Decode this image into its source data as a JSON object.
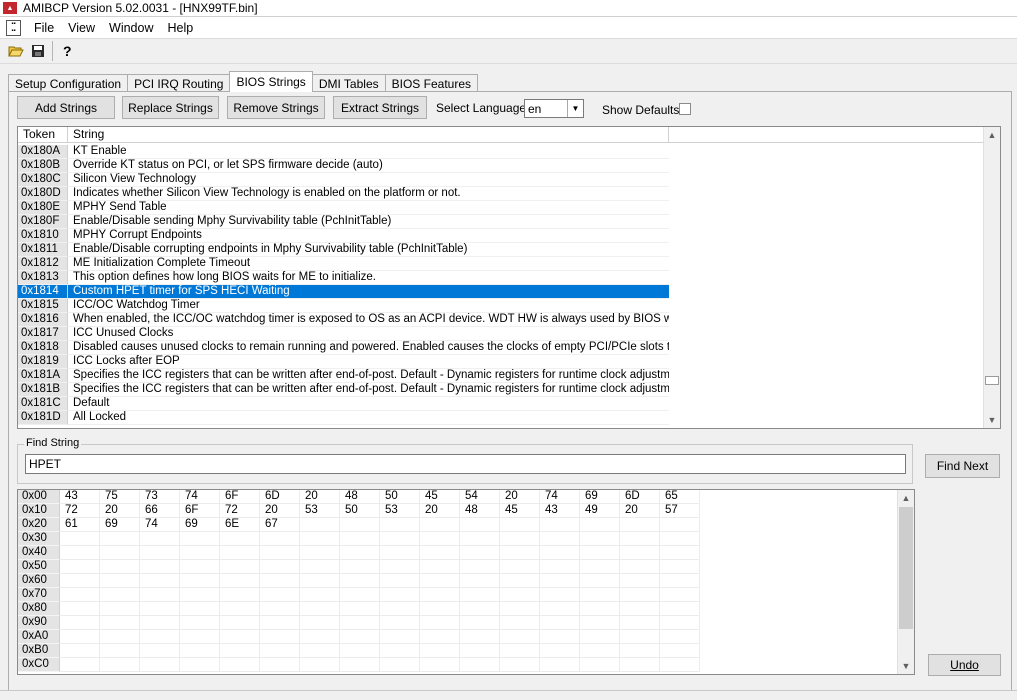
{
  "window": {
    "title": "AMIBCP Version 5.02.0031 - [HNX99TF.bin]"
  },
  "menu": {
    "items": [
      "File",
      "View",
      "Window",
      "Help"
    ]
  },
  "tabs": [
    "Setup Configuration",
    "PCI IRQ Routing",
    "BIOS Strings",
    "DMI Tables",
    "BIOS Features"
  ],
  "active_tab": "BIOS Strings",
  "actions": {
    "add": "Add Strings",
    "replace": "Replace Strings",
    "remove": "Remove Strings",
    "extract": "Extract Strings",
    "select_language_label": "Select Language",
    "language_value": "en",
    "show_defaults_label": "Show Defaults"
  },
  "strings_table": {
    "columns": [
      "Token",
      "String"
    ],
    "rows": [
      {
        "token": "0x180A",
        "string": "KT Enable"
      },
      {
        "token": "0x180B",
        "string": "Override KT status on PCI, or let SPS firmware decide (auto)"
      },
      {
        "token": "0x180C",
        "string": "Silicon View Technology"
      },
      {
        "token": "0x180D",
        "string": "Indicates whether Silicon View Technology is enabled on the platform or not."
      },
      {
        "token": "0x180E",
        "string": "MPHY Send Table"
      },
      {
        "token": "0x180F",
        "string": "Enable/Disable sending Mphy Survivability table (PchInitTable)"
      },
      {
        "token": "0x1810",
        "string": "MPHY Corrupt Endpoints"
      },
      {
        "token": "0x1811",
        "string": "Enable/Disable corrupting endpoints in Mphy Survivability table (PchInitTable)"
      },
      {
        "token": "0x1812",
        "string": "ME Initialization Complete Timeout"
      },
      {
        "token": "0x1813",
        "string": "This option defines how long BIOS waits for ME to initialize."
      },
      {
        "token": "0x1814",
        "string": "Custom HPET timer for SPS HECI Waiting",
        "selected": true
      },
      {
        "token": "0x1815",
        "string": "ICC/OC Watchdog Timer"
      },
      {
        "token": "0x1816",
        "string": "When enabled, the ICC/OC watchdog timer is exposed to OS as an ACPI device. WDT HW is always used by BIOS when ..."
      },
      {
        "token": "0x1817",
        "string": "ICC Unused Clocks"
      },
      {
        "token": "0x1818",
        "string": "Disabled causes unused clocks to remain running and powered. Enabled causes the clocks of empty PCI/PCIe slots to be ..."
      },
      {
        "token": "0x1819",
        "string": "ICC Locks after EOP"
      },
      {
        "token": "0x181A",
        "string": "Specifies the ICC registers that can be written after end-of-post. Default - Dynamic registers for runtime clock adjustments ar..."
      },
      {
        "token": "0x181B",
        "string": "Specifies the ICC registers that can be written after end-of-post. Default - Dynamic registers for runtime clock adjustments ar..."
      },
      {
        "token": "0x181C",
        "string": "Default"
      },
      {
        "token": "0x181D",
        "string": "All Locked"
      }
    ]
  },
  "find": {
    "group_label": "Find String",
    "value": "HPET",
    "button": "Find Next"
  },
  "hex_table": {
    "rows": [
      {
        "addr": "0x00",
        "bytes": [
          "43",
          "75",
          "73",
          "74",
          "6F",
          "6D",
          "20",
          "48",
          "50",
          "45",
          "54",
          "20",
          "74",
          "69",
          "6D",
          "65"
        ]
      },
      {
        "addr": "0x10",
        "bytes": [
          "72",
          "20",
          "66",
          "6F",
          "72",
          "20",
          "53",
          "50",
          "53",
          "20",
          "48",
          "45",
          "43",
          "49",
          "20",
          "57"
        ]
      },
      {
        "addr": "0x20",
        "bytes": [
          "61",
          "69",
          "74",
          "69",
          "6E",
          "67",
          "",
          "",
          "",
          "",
          "",
          "",
          "",
          "",
          "",
          ""
        ]
      },
      {
        "addr": "0x30",
        "bytes": [
          "",
          "",
          "",
          "",
          "",
          "",
          "",
          "",
          "",
          "",
          "",
          "",
          "",
          "",
          "",
          ""
        ]
      },
      {
        "addr": "0x40",
        "bytes": [
          "",
          "",
          "",
          "",
          "",
          "",
          "",
          "",
          "",
          "",
          "",
          "",
          "",
          "",
          "",
          ""
        ]
      },
      {
        "addr": "0x50",
        "bytes": [
          "",
          "",
          "",
          "",
          "",
          "",
          "",
          "",
          "",
          "",
          "",
          "",
          "",
          "",
          "",
          ""
        ]
      },
      {
        "addr": "0x60",
        "bytes": [
          "",
          "",
          "",
          "",
          "",
          "",
          "",
          "",
          "",
          "",
          "",
          "",
          "",
          "",
          "",
          ""
        ]
      },
      {
        "addr": "0x70",
        "bytes": [
          "",
          "",
          "",
          "",
          "",
          "",
          "",
          "",
          "",
          "",
          "",
          "",
          "",
          "",
          "",
          ""
        ]
      },
      {
        "addr": "0x80",
        "bytes": [
          "",
          "",
          "",
          "",
          "",
          "",
          "",
          "",
          "",
          "",
          "",
          "",
          "",
          "",
          "",
          ""
        ]
      },
      {
        "addr": "0x90",
        "bytes": [
          "",
          "",
          "",
          "",
          "",
          "",
          "",
          "",
          "",
          "",
          "",
          "",
          "",
          "",
          "",
          ""
        ]
      },
      {
        "addr": "0xA0",
        "bytes": [
          "",
          "",
          "",
          "",
          "",
          "",
          "",
          "",
          "",
          "",
          "",
          "",
          "",
          "",
          "",
          ""
        ]
      },
      {
        "addr": "0xB0",
        "bytes": [
          "",
          "",
          "",
          "",
          "",
          "",
          "",
          "",
          "",
          "",
          "",
          "",
          "",
          "",
          "",
          ""
        ]
      },
      {
        "addr": "0xC0",
        "bytes": [
          "",
          "",
          "",
          "",
          "",
          "",
          "",
          "",
          "",
          "",
          "",
          "",
          "",
          "",
          "",
          ""
        ]
      }
    ]
  },
  "undo": {
    "label": "Undo"
  },
  "colors": {
    "selection": "#0078d7",
    "token_bg": "#e4e4e4",
    "window_bg": "#f0f0f0",
    "brand": "#c1272d"
  },
  "icons": [
    "app-icon",
    "rom-icon",
    "open-folder-icon",
    "save-icon",
    "help-icon",
    "chevron-up-icon",
    "chevron-down-icon",
    "dropdown-arrow-icon"
  ]
}
